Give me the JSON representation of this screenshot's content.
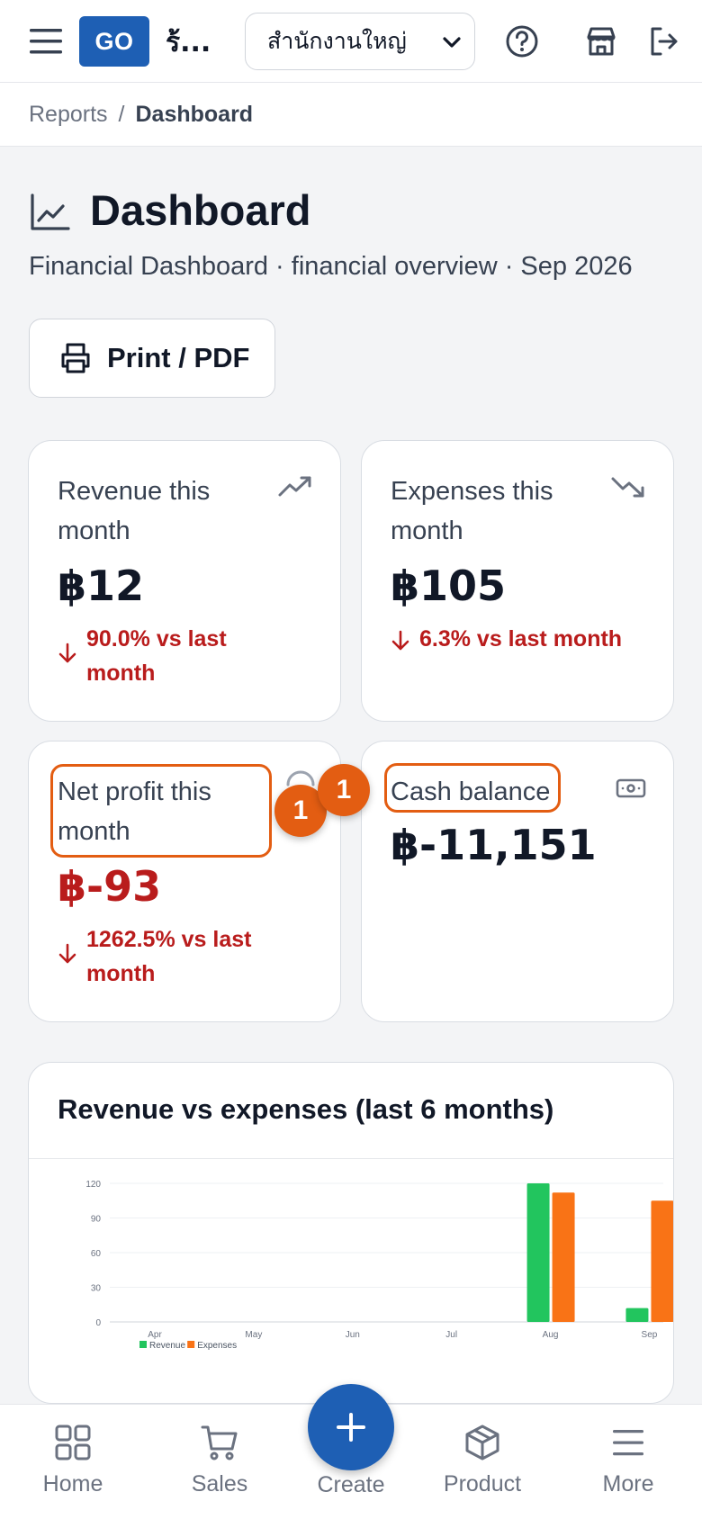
{
  "header": {
    "logo_text": "GO",
    "shop_name": "ร้...",
    "branch_selected": "สำนักงานใหญ่"
  },
  "breadcrumb": {
    "items": [
      "Reports",
      "Dashboard"
    ],
    "separator": "/"
  },
  "page": {
    "title": "Dashboard",
    "subtitle": "Financial Dashboard · financial overview · Sep 2026",
    "print_label": "Print / PDF"
  },
  "cards": {
    "revenue": {
      "label": "Revenue this month",
      "value": "฿12",
      "trend": "90.0% vs last month",
      "icon": "trending-up-icon"
    },
    "expenses": {
      "label": "Expenses this month",
      "value": "฿105",
      "trend": "6.3% vs last month",
      "icon": "trending-down-icon"
    },
    "net_profit": {
      "label": "Net profit this month",
      "value": "฿-93",
      "trend": "1262.5% vs last month",
      "icon": "loading-icon"
    },
    "cash": {
      "label": "Cash balance",
      "value": "฿-11,151",
      "icon": "banknote-icon"
    }
  },
  "annotations": {
    "badge_1": "1",
    "badge_2": "1",
    "highlight_color": "#e35d12"
  },
  "chart": {
    "title": "Revenue vs expenses (last 6 months)"
  },
  "chart_data": {
    "type": "bar",
    "categories": [
      "Apr",
      "May",
      "Jun",
      "Jul",
      "Aug",
      "Sep"
    ],
    "series": [
      {
        "name": "Revenue",
        "color": "#22c55e",
        "values": [
          0,
          0,
          0,
          0,
          120,
          12
        ]
      },
      {
        "name": "Expenses",
        "color": "#f97316",
        "values": [
          0,
          0,
          0,
          0,
          112,
          105
        ]
      }
    ],
    "yticks": [
      0,
      30,
      60,
      90,
      120
    ],
    "ylim": [
      0,
      120
    ],
    "legend": "bottom-left",
    "grid": true
  },
  "nav": {
    "home": "Home",
    "sales": "Sales",
    "create": "Create",
    "product": "Product",
    "more": "More"
  },
  "colors": {
    "brand": "#1e5fb4",
    "negative": "#b91c1c",
    "highlight": "#e35d12"
  }
}
